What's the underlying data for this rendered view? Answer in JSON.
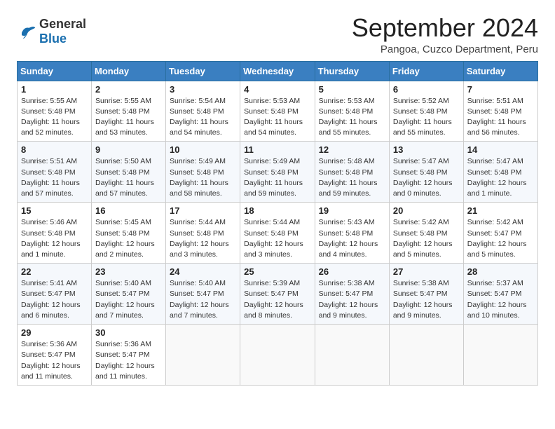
{
  "logo": {
    "general": "General",
    "blue": "Blue"
  },
  "header": {
    "month": "September 2024",
    "location": "Pangoa, Cuzco Department, Peru"
  },
  "weekdays": [
    "Sunday",
    "Monday",
    "Tuesday",
    "Wednesday",
    "Thursday",
    "Friday",
    "Saturday"
  ],
  "weeks": [
    [
      {
        "day": "1",
        "sunrise": "5:55 AM",
        "sunset": "5:48 PM",
        "daylight": "11 hours and 52 minutes."
      },
      {
        "day": "2",
        "sunrise": "5:55 AM",
        "sunset": "5:48 PM",
        "daylight": "11 hours and 53 minutes."
      },
      {
        "day": "3",
        "sunrise": "5:54 AM",
        "sunset": "5:48 PM",
        "daylight": "11 hours and 54 minutes."
      },
      {
        "day": "4",
        "sunrise": "5:53 AM",
        "sunset": "5:48 PM",
        "daylight": "11 hours and 54 minutes."
      },
      {
        "day": "5",
        "sunrise": "5:53 AM",
        "sunset": "5:48 PM",
        "daylight": "11 hours and 55 minutes."
      },
      {
        "day": "6",
        "sunrise": "5:52 AM",
        "sunset": "5:48 PM",
        "daylight": "11 hours and 55 minutes."
      },
      {
        "day": "7",
        "sunrise": "5:51 AM",
        "sunset": "5:48 PM",
        "daylight": "11 hours and 56 minutes."
      }
    ],
    [
      {
        "day": "8",
        "sunrise": "5:51 AM",
        "sunset": "5:48 PM",
        "daylight": "11 hours and 57 minutes."
      },
      {
        "day": "9",
        "sunrise": "5:50 AM",
        "sunset": "5:48 PM",
        "daylight": "11 hours and 57 minutes."
      },
      {
        "day": "10",
        "sunrise": "5:49 AM",
        "sunset": "5:48 PM",
        "daylight": "11 hours and 58 minutes."
      },
      {
        "day": "11",
        "sunrise": "5:49 AM",
        "sunset": "5:48 PM",
        "daylight": "11 hours and 59 minutes."
      },
      {
        "day": "12",
        "sunrise": "5:48 AM",
        "sunset": "5:48 PM",
        "daylight": "11 hours and 59 minutes."
      },
      {
        "day": "13",
        "sunrise": "5:47 AM",
        "sunset": "5:48 PM",
        "daylight": "12 hours and 0 minutes."
      },
      {
        "day": "14",
        "sunrise": "5:47 AM",
        "sunset": "5:48 PM",
        "daylight": "12 hours and 1 minute."
      }
    ],
    [
      {
        "day": "15",
        "sunrise": "5:46 AM",
        "sunset": "5:48 PM",
        "daylight": "12 hours and 1 minute."
      },
      {
        "day": "16",
        "sunrise": "5:45 AM",
        "sunset": "5:48 PM",
        "daylight": "12 hours and 2 minutes."
      },
      {
        "day": "17",
        "sunrise": "5:44 AM",
        "sunset": "5:48 PM",
        "daylight": "12 hours and 3 minutes."
      },
      {
        "day": "18",
        "sunrise": "5:44 AM",
        "sunset": "5:48 PM",
        "daylight": "12 hours and 3 minutes."
      },
      {
        "day": "19",
        "sunrise": "5:43 AM",
        "sunset": "5:48 PM",
        "daylight": "12 hours and 4 minutes."
      },
      {
        "day": "20",
        "sunrise": "5:42 AM",
        "sunset": "5:48 PM",
        "daylight": "12 hours and 5 minutes."
      },
      {
        "day": "21",
        "sunrise": "5:42 AM",
        "sunset": "5:47 PM",
        "daylight": "12 hours and 5 minutes."
      }
    ],
    [
      {
        "day": "22",
        "sunrise": "5:41 AM",
        "sunset": "5:47 PM",
        "daylight": "12 hours and 6 minutes."
      },
      {
        "day": "23",
        "sunrise": "5:40 AM",
        "sunset": "5:47 PM",
        "daylight": "12 hours and 7 minutes."
      },
      {
        "day": "24",
        "sunrise": "5:40 AM",
        "sunset": "5:47 PM",
        "daylight": "12 hours and 7 minutes."
      },
      {
        "day": "25",
        "sunrise": "5:39 AM",
        "sunset": "5:47 PM",
        "daylight": "12 hours and 8 minutes."
      },
      {
        "day": "26",
        "sunrise": "5:38 AM",
        "sunset": "5:47 PM",
        "daylight": "12 hours and 9 minutes."
      },
      {
        "day": "27",
        "sunrise": "5:38 AM",
        "sunset": "5:47 PM",
        "daylight": "12 hours and 9 minutes."
      },
      {
        "day": "28",
        "sunrise": "5:37 AM",
        "sunset": "5:47 PM",
        "daylight": "12 hours and 10 minutes."
      }
    ],
    [
      {
        "day": "29",
        "sunrise": "5:36 AM",
        "sunset": "5:47 PM",
        "daylight": "12 hours and 11 minutes."
      },
      {
        "day": "30",
        "sunrise": "5:36 AM",
        "sunset": "5:47 PM",
        "daylight": "12 hours and 11 minutes."
      },
      null,
      null,
      null,
      null,
      null
    ]
  ]
}
